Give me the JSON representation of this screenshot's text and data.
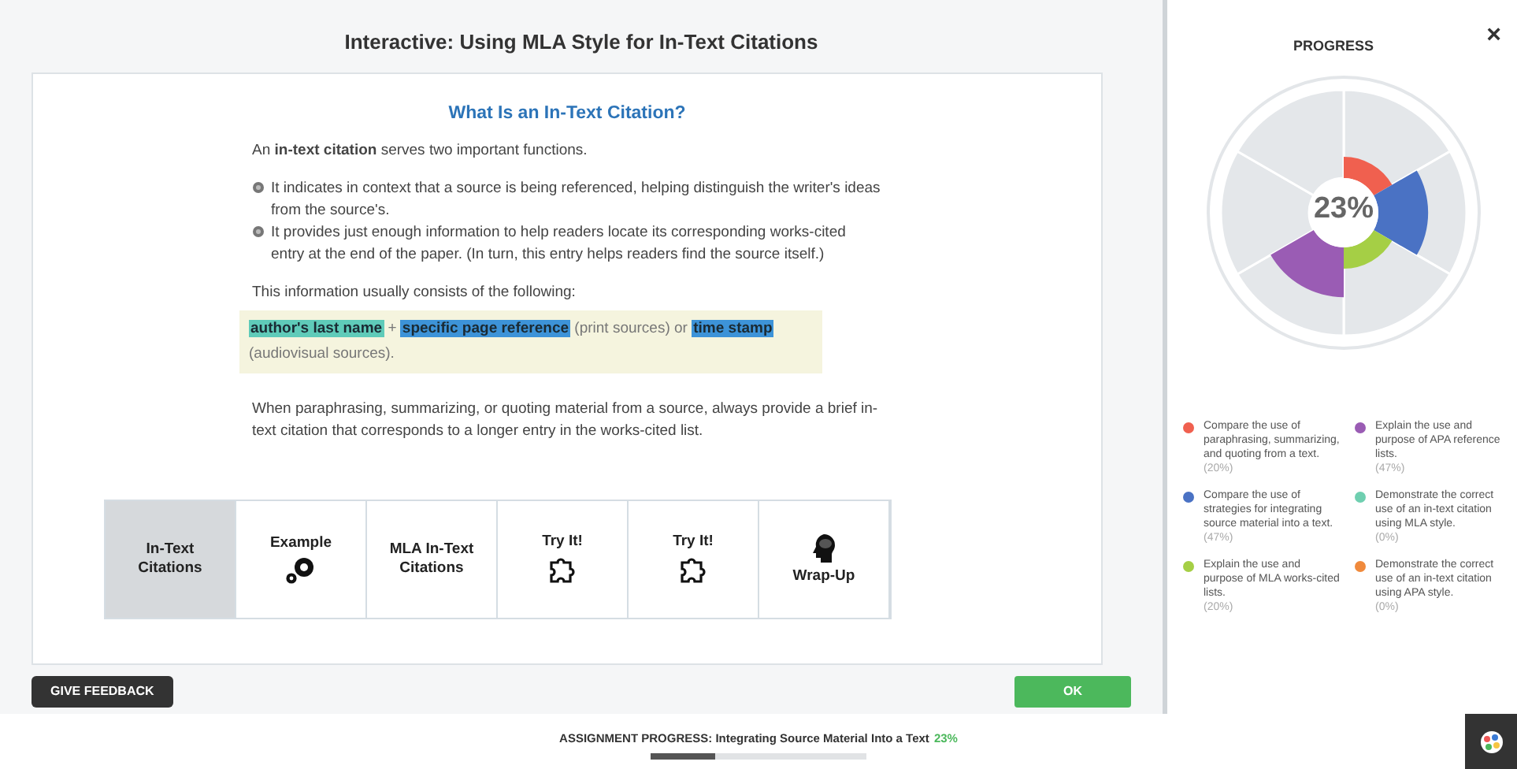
{
  "activity": {
    "title": "Interactive: Using MLA Style for In-Text Citations",
    "heading": "What Is an In-Text Citation?",
    "intro": "An **in-text citation** serves two important functions.",
    "bullets": [
      "It indicates in context that a source is being referenced, helping distinguish the writer's ideas from the source's.",
      "It provides just enough information to help readers locate its corresponding works-cited entry at the end of the paper. (In turn, this entry helps readers find the source itself.)"
    ],
    "lead": "This information usually consists of the following:",
    "formula": [
      {
        "kind": "highlight",
        "text": "author's last name",
        "color": "#5fcbb9"
      },
      {
        "kind": "plain",
        "text": "+"
      },
      {
        "kind": "highlight",
        "text": "specific page reference",
        "color": "#3d93d8"
      },
      {
        "kind": "plain",
        "text": "(print sources) or"
      },
      {
        "kind": "highlight",
        "text": "time stamp",
        "color": "#3d93d8"
      },
      {
        "kind": "plain",
        "text": "(audiovisual sources)."
      }
    ],
    "closing": "When paraphrasing, summarizing, or quoting material from a source, always provide a brief in-text citation that corresponds to a longer entry in the works-cited list.",
    "tabs": [
      {
        "label": "In-Text Citations",
        "kind": "text",
        "selected": true
      },
      {
        "label": "Example",
        "kind": "gears",
        "selected": false
      },
      {
        "label": "MLA In-Text Citations",
        "kind": "text",
        "selected": false
      },
      {
        "label": "Try It!",
        "kind": "puzzle",
        "selected": false
      },
      {
        "label": "Try It!",
        "kind": "puzzle",
        "selected": false
      },
      {
        "label": "Wrap-Up",
        "kind": "head",
        "selected": false
      }
    ],
    "feedback_button": "GIVE FEEDBACK",
    "ok_button": "OK"
  },
  "progress_panel": {
    "title": "PROGRESS",
    "close": "×",
    "percent": "23%",
    "objectives": [
      {
        "text": "Compare the use of paraphrasing, summarizing, and quoting from a text.",
        "percent": "(20%)",
        "color": "#f0604f"
      },
      {
        "text": "Compare the use of strategies for integrating source material into a text.",
        "percent": "(47%)",
        "color": "#4a72c4"
      },
      {
        "text": "Explain the use and purpose of MLA works-cited lists.",
        "percent": "(20%)",
        "color": "#a5cf45"
      },
      {
        "text": "Explain the use and purpose of APA reference lists.",
        "percent": "(47%)",
        "color": "#9a5cb4"
      },
      {
        "text": "Demonstrate the correct use of an in-text citation using MLA style.",
        "percent": "(0%)",
        "color": "#6fcfb0"
      },
      {
        "text": "Demonstrate the correct use of an in-text citation using APA style.",
        "percent": "(0%)",
        "color": "#f08a3c"
      }
    ]
  },
  "assignment": {
    "label": "ASSIGNMENT PROGRESS: Integrating Source Material Into a Text",
    "percent": "23%",
    "level": 0.3
  }
}
